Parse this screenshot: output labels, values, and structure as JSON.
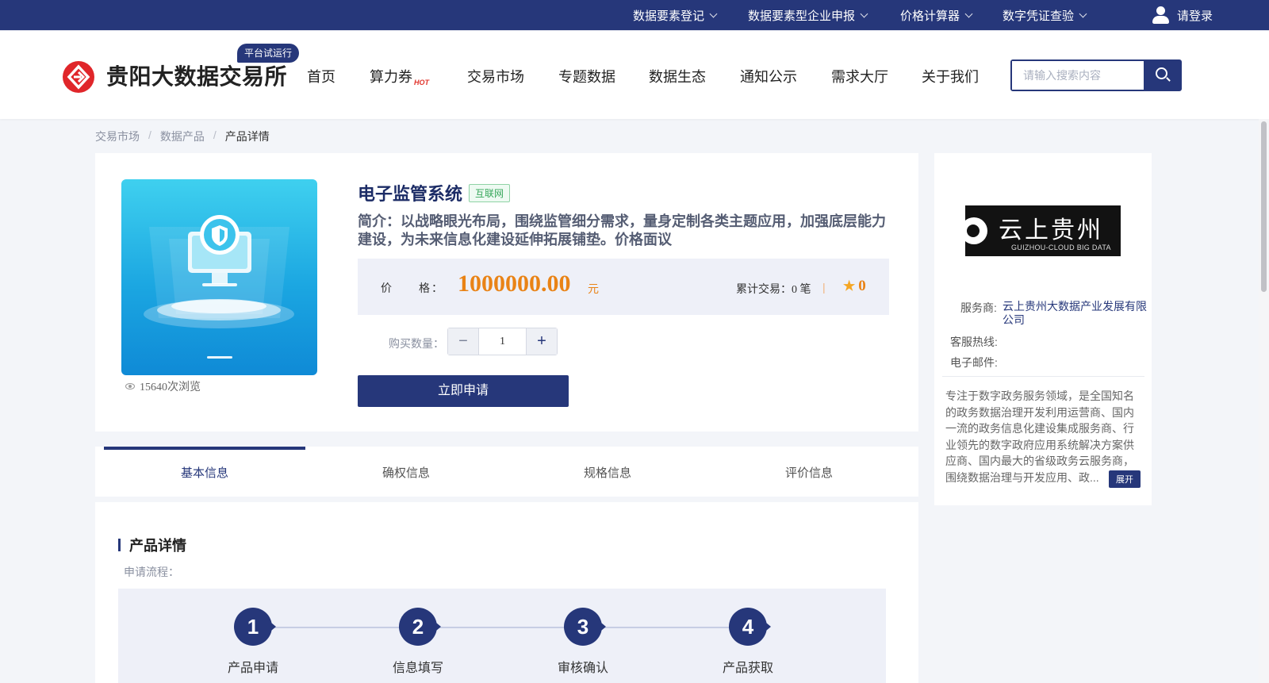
{
  "topbar": {
    "items": [
      {
        "label": "数据要素登记"
      },
      {
        "label": "数据要素型企业申报"
      },
      {
        "label": "价格计算器"
      },
      {
        "label": "数字凭证查验"
      }
    ],
    "login_label": "请登录"
  },
  "header": {
    "logo_text": "贵阳大数据交易所",
    "badge": "平台试运行",
    "nav": [
      "首页",
      "算力券",
      "交易市场",
      "专题数据",
      "数据生态",
      "通知公示",
      "需求大厅",
      "关于我们"
    ],
    "hot_label": "HOT",
    "search_placeholder": "请输入搜索内容"
  },
  "breadcrumb": [
    "交易市场",
    "数据产品",
    "产品详情"
  ],
  "product": {
    "title": "电子监管系统",
    "tag": "互联网",
    "intro": "简介：以战略眼光布局，围绕监管细分需求，量身定制各类主题应用，加强底层能力建设，为未来信息化建设延伸拓展铺垫。价格面议",
    "price_label": "价　　格：",
    "price": "1000000.00",
    "price_unit": "元",
    "deals": "累计交易：0 笔",
    "rating": "0",
    "views": "15640次浏览",
    "qty_label": "购买数量：",
    "qty": "1",
    "apply_label": "立即申请"
  },
  "tabs": [
    "基本信息",
    "确权信息",
    "规格信息",
    "评价信息"
  ],
  "details": {
    "title": "产品详情",
    "flow_label": "申请流程：",
    "steps": [
      {
        "num": "1",
        "label": "产品申请"
      },
      {
        "num": "2",
        "label": "信息填写"
      },
      {
        "num": "3",
        "label": "审核确认"
      },
      {
        "num": "4",
        "label": "产品获取"
      }
    ]
  },
  "provider": {
    "logo_cn": "云上贵州",
    "logo_en": "GUIZHOU-CLOUD BIG DATA",
    "provider_label": "服务商:",
    "provider_name": "云上贵州大数据产业发展有限公司",
    "hotline_label": "客服热线:",
    "email_label": "电子邮件:",
    "description": "专注于数字政务服务领域，是全国知名的政务数据治理开发利用运营商、国内一流的政务信息化建设集成服务商、行业领先的数字政府应用系统解决方案供应商、国内最大的省级政务云服务商，围绕数据治理与开发应用、政...",
    "expand_label": "展开"
  },
  "colors": {
    "primary": "#26377a",
    "price": "#e98316",
    "tag_green": "#37a75b"
  }
}
